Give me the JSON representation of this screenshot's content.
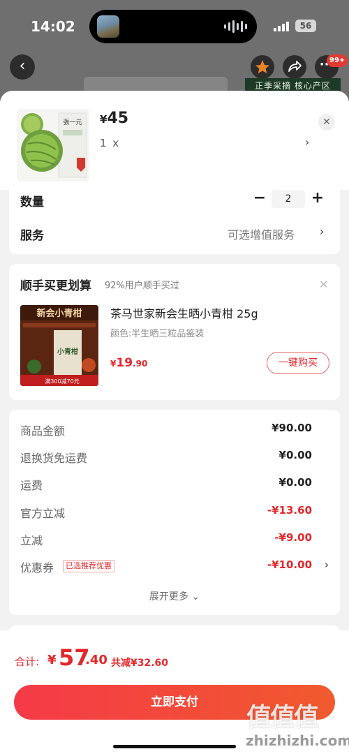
{
  "status_bar": {
    "time": "14:02",
    "battery": "56"
  },
  "nav": {
    "back_icon": "chevron-left-icon",
    "more_badge": "99+",
    "banner": "正季采摘 核心产区"
  },
  "product": {
    "currency": "¥",
    "price": "45",
    "spec": "1 x",
    "package_brand": "張一元"
  },
  "quantity": {
    "label": "数量",
    "value": "2",
    "minus": "−",
    "plus": "+"
  },
  "service": {
    "label": "服务",
    "value": "可选增值服务"
  },
  "addon": {
    "title": "顺手买更划算",
    "subtitle": "92%用户顺手买过",
    "name": "茶马世家新会生晒小青柑 25g",
    "spec": "颜色:半生晒三粒品鉴装",
    "price_currency": "¥",
    "price_int": "19",
    "price_dec": ".90",
    "buy_button": "一键购买",
    "image_title": "新会小青柑",
    "image_box": "小青柑",
    "image_promo": "满300减70元"
  },
  "summary": {
    "rows": [
      {
        "label": "商品金额",
        "value": "¥90.00"
      },
      {
        "label": "退换货免运费",
        "value": "¥0.00"
      },
      {
        "label": "运费",
        "value": "¥0.00"
      },
      {
        "label": "官方立减",
        "value": "-¥13.60"
      },
      {
        "label": "立减",
        "value": "-¥9.00"
      },
      {
        "label": "优惠券",
        "value": "-¥10.00",
        "tag": "已选推荐优惠"
      }
    ],
    "expand": "展开更多 ⌄"
  },
  "total": {
    "label": "合计:",
    "currency": "¥",
    "int": "57",
    "dec": ".40",
    "saved": "共减¥32.60"
  },
  "pay_button": "立即支付",
  "watermark": {
    "logo": "值值值",
    "text": "zhizhizhi.com"
  },
  "colors": {
    "accent_red": "#e2282c",
    "pay_gradient_start": "#f43a47",
    "pay_gradient_end": "#f15a2e"
  }
}
